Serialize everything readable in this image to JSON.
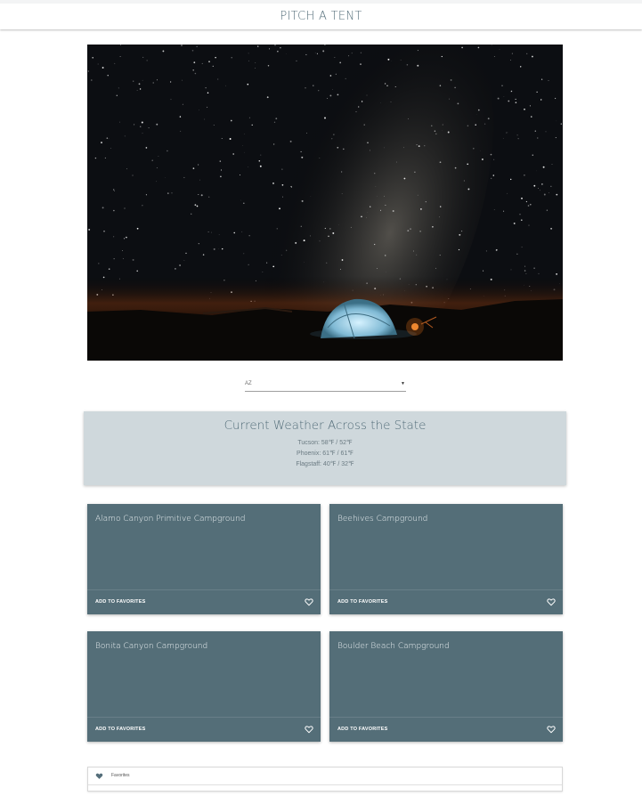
{
  "header": {
    "title": "PITCH A TENT"
  },
  "state_select": {
    "value": "AZ"
  },
  "weather": {
    "title": "Current Weather Across the State",
    "cities": [
      {
        "text": "Tucson: 58℉ / 52℉"
      },
      {
        "text": "Phoenix: 61℉ / 61℉"
      },
      {
        "text": "Flagstaff: 40℉ / 32℉"
      }
    ]
  },
  "campgrounds": [
    {
      "name": "Alamo Canyon Primitive Campground",
      "action": "ADD TO FAVORITES"
    },
    {
      "name": "Beehives Campground",
      "action": "ADD TO FAVORITES"
    },
    {
      "name": "Bonita Canyon Campground",
      "action": "ADD TO FAVORITES"
    },
    {
      "name": "Boulder Beach Campground",
      "action": "ADD TO FAVORITES"
    }
  ],
  "favorites": {
    "label": "Favorites"
  },
  "icons": {
    "heart": "heart-outline-icon",
    "favorites": "heart-filled-icon",
    "dropdown": "caret-down-icon"
  },
  "colors": {
    "accent": "#546e7a",
    "card": "#546e78",
    "weather_bg": "#cfd8dc"
  }
}
